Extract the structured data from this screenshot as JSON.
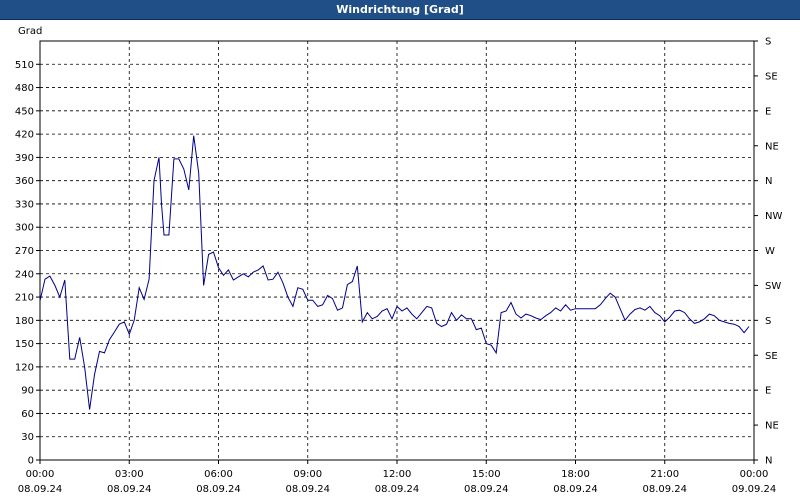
{
  "window": {
    "title": "Windrichtung [Grad]"
  },
  "chart_data": {
    "type": "line",
    "title": "Windrichtung [Grad]",
    "ylabel": "Grad",
    "ylim": [
      0,
      540
    ],
    "y_ticks": [
      0,
      30,
      60,
      90,
      120,
      150,
      180,
      210,
      240,
      270,
      300,
      330,
      360,
      390,
      420,
      450,
      480,
      510
    ],
    "xlim": [
      "2024-09-08 00:00",
      "2024-09-09 00:00"
    ],
    "x_ticks": [
      {
        "time": "00:00",
        "date": "08.09.24"
      },
      {
        "time": "03:00",
        "date": "08.09.24"
      },
      {
        "time": "06:00",
        "date": "08.09.24"
      },
      {
        "time": "09:00",
        "date": "08.09.24"
      },
      {
        "time": "12:00",
        "date": "08.09.24"
      },
      {
        "time": "15:00",
        "date": "08.09.24"
      },
      {
        "time": "18:00",
        "date": "08.09.24"
      },
      {
        "time": "21:00",
        "date": "08.09.24"
      },
      {
        "time": "00:00",
        "date": "09.09.24"
      }
    ],
    "right_axis_ticks": [
      {
        "deg": 0,
        "label": "N"
      },
      {
        "deg": 45,
        "label": "NE"
      },
      {
        "deg": 90,
        "label": "E"
      },
      {
        "deg": 135,
        "label": "SE"
      },
      {
        "deg": 180,
        "label": "S"
      },
      {
        "deg": 225,
        "label": "SW"
      },
      {
        "deg": 270,
        "label": "W"
      },
      {
        "deg": 315,
        "label": "NW"
      },
      {
        "deg": 360,
        "label": "N"
      },
      {
        "deg": 405,
        "label": "NE"
      },
      {
        "deg": 450,
        "label": "E"
      },
      {
        "deg": 495,
        "label": "SE"
      },
      {
        "deg": 540,
        "label": "S"
      }
    ],
    "grid": true,
    "line_color": "#00008b",
    "series": [
      {
        "x": [
          "00:00",
          "00:10",
          "00:20",
          "00:30",
          "00:40",
          "00:50",
          "01:00",
          "01:10",
          "01:20",
          "01:30",
          "01:40",
          "01:50",
          "02:00",
          "02:10",
          "02:20",
          "02:30",
          "02:40",
          "02:50",
          "03:00",
          "03:10",
          "03:20",
          "03:30",
          "03:40",
          "03:50",
          "04:00",
          "04:05",
          "04:10",
          "04:20",
          "04:30",
          "04:40",
          "04:50",
          "05:00",
          "05:10",
          "05:20",
          "05:30",
          "05:40",
          "05:50",
          "06:00",
          "06:10",
          "06:20",
          "06:30",
          "06:40",
          "06:50",
          "07:00",
          "07:10",
          "07:20",
          "07:30",
          "07:40",
          "07:50",
          "08:00",
          "08:10",
          "08:20",
          "08:30",
          "08:40",
          "08:50",
          "09:00",
          "09:10",
          "09:20",
          "09:30",
          "09:40",
          "09:50",
          "10:00",
          "10:10",
          "10:20",
          "10:30",
          "10:40",
          "10:50",
          "11:00",
          "11:10",
          "11:20",
          "11:30",
          "11:40",
          "11:50",
          "12:00",
          "12:10",
          "12:20",
          "12:30",
          "12:40",
          "12:50",
          "13:00",
          "13:10",
          "13:20",
          "13:30",
          "13:40",
          "13:50",
          "14:00",
          "14:10",
          "14:20",
          "14:30",
          "14:40",
          "14:50",
          "15:00",
          "15:10",
          "15:20",
          "15:30",
          "15:40",
          "15:50",
          "16:00",
          "16:10",
          "16:20",
          "16:30",
          "16:40",
          "16:50",
          "17:00",
          "17:10",
          "17:20",
          "17:30",
          "17:40",
          "17:50",
          "18:00",
          "18:10",
          "18:20",
          "18:30",
          "18:40",
          "18:50",
          "19:00",
          "19:10",
          "19:20",
          "19:30",
          "19:40",
          "19:50",
          "20:00",
          "20:10",
          "20:20",
          "20:30",
          "20:40",
          "20:50",
          "21:00",
          "21:10",
          "21:20",
          "21:30",
          "21:40",
          "21:50",
          "22:00",
          "22:10",
          "22:20",
          "22:30",
          "22:40",
          "22:50",
          "23:00",
          "23:10",
          "23:20",
          "23:30",
          "23:40",
          "23:50"
        ],
        "values": [
          205,
          233,
          237,
          225,
          210,
          232,
          130,
          130,
          158,
          120,
          65,
          110,
          140,
          138,
          155,
          165,
          175,
          178,
          162,
          180,
          222,
          207,
          233,
          360,
          390,
          330,
          290,
          290,
          388,
          388,
          375,
          348,
          418,
          370,
          225,
          265,
          268,
          248,
          238,
          245,
          232,
          236,
          240,
          236,
          242,
          245,
          250,
          232,
          233,
          242,
          228,
          210,
          198,
          222,
          220,
          206,
          206,
          198,
          200,
          212,
          208,
          193,
          196,
          226,
          230,
          250,
          178,
          190,
          182,
          185,
          192,
          195,
          182,
          198,
          192,
          196,
          188,
          182,
          190,
          198,
          196,
          176,
          172,
          175,
          190,
          180,
          187,
          182,
          182,
          168,
          170,
          150,
          148,
          138,
          190,
          192,
          203,
          188,
          183,
          188,
          186,
          183,
          181,
          186,
          190,
          196,
          192,
          200,
          193,
          195,
          195,
          195,
          195,
          195,
          200,
          208,
          215,
          210,
          195,
          180,
          188,
          194,
          196,
          193,
          198,
          190,
          186,
          178,
          184,
          192,
          193,
          190,
          182,
          176,
          178,
          182,
          188,
          186,
          180,
          178,
          176,
          175,
          172,
          164,
          172
        ]
      }
    ]
  }
}
